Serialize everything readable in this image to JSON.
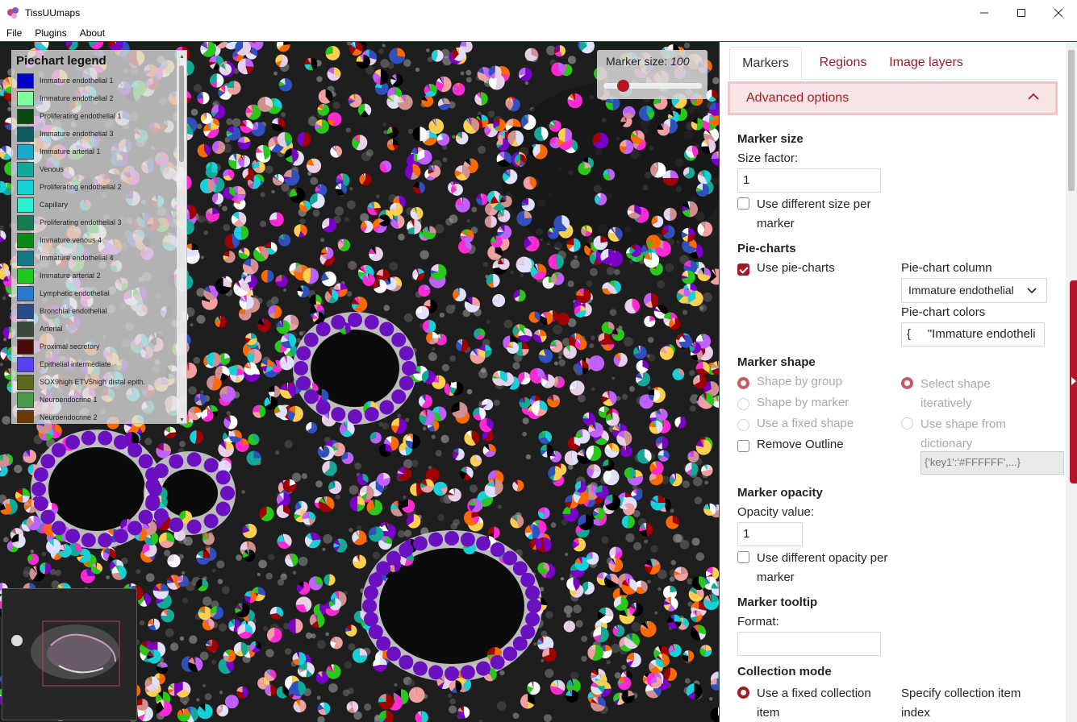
{
  "window": {
    "title": "TissUUmaps",
    "icon": "tissuumaps-logo-icon",
    "controls": [
      "minimize-icon",
      "maximize-icon",
      "close-icon"
    ]
  },
  "menubar": {
    "items": [
      "File",
      "Plugins",
      "About"
    ]
  },
  "legend": {
    "title": "Piechart legend",
    "items": [
      {
        "label": "Immature endothelial 1",
        "color": "#0000cc"
      },
      {
        "label": "Immature endothelial 2",
        "color": "#80ff9f"
      },
      {
        "label": "Proliferating endothelial 1",
        "color": "#0c4a12"
      },
      {
        "label": "Immature endothelial 3",
        "color": "#0e5a5e"
      },
      {
        "label": "Immature arterial 1",
        "color": "#1aa7c9"
      },
      {
        "label": "Venous",
        "color": "#14a896"
      },
      {
        "label": "Proliferating endothelial 2",
        "color": "#18d0d8"
      },
      {
        "label": "Capillary",
        "color": "#28f0d0"
      },
      {
        "label": "Proliferating endothelial 3",
        "color": "#167a52"
      },
      {
        "label": "Immature venous 4",
        "color": "#0a8a16"
      },
      {
        "label": "Immature endothelial 4",
        "color": "#147a86"
      },
      {
        "label": "Immature arterial 2",
        "color": "#1ec81a"
      },
      {
        "label": "Lymphatic endothelial",
        "color": "#2a78c8"
      },
      {
        "label": "Bronchial endothelial",
        "color": "#2a4d8a"
      },
      {
        "label": "Arterial",
        "color": "#3a4a3a"
      },
      {
        "label": "Proximal secretory",
        "color": "#4a0a0a"
      },
      {
        "label": "Epithelial intermediate",
        "color": "#5a40f0"
      },
      {
        "label": "SOX9high ETV5high distal epith.",
        "color": "#5a6a20"
      },
      {
        "label": "Neuroendocrine 1",
        "color": "#4a9a4a"
      },
      {
        "label": "Neuroendocrine 2",
        "color": "#6a3a06"
      }
    ]
  },
  "marker_size_overlay": {
    "label": "Marker size:",
    "value": "100",
    "slider_fraction": 0.2
  },
  "panel": {
    "tabs": [
      "Markers",
      "Regions",
      "Image layers"
    ],
    "active_tab": "Markers",
    "advanced_options": "Advanced options",
    "marker_size": {
      "title": "Marker size",
      "size_factor_label": "Size factor:",
      "size_factor_value": "1",
      "diff_size_label": "Use different size per marker"
    },
    "pie_charts": {
      "title": "Pie-charts",
      "use_label": "Use pie-charts",
      "column_label": "Pie-chart column",
      "column_value": "Immature endothelial",
      "colors_label": "Pie-chart colors",
      "colors_value": "{     \"Immature endotheli"
    },
    "marker_shape": {
      "title": "Marker shape",
      "by_group": "Shape by group",
      "by_marker": "Shape by marker",
      "fixed": "Use a fixed shape",
      "remove_outline": "Remove Outline",
      "select_iter": "Select shape iteratively",
      "from_dict": "Use shape from dictionary",
      "dict_placeholder": "{'key1':'#FFFFFF',...}"
    },
    "marker_opacity": {
      "title": "Marker opacity",
      "value_label": "Opacity value:",
      "value": "1",
      "diff_label": "Use different opacity per marker"
    },
    "marker_tooltip": {
      "title": "Marker tooltip",
      "format_label": "Format:",
      "format_value": ""
    },
    "collection_mode": {
      "title": "Collection mode",
      "fixed_label": "Use a fixed collection item",
      "index_label": "Specify collection item index"
    }
  },
  "colors": {
    "accent": "#a01a28",
    "accent_light": "#f7e4e5",
    "viewer_bg": "#1c1c1c"
  }
}
